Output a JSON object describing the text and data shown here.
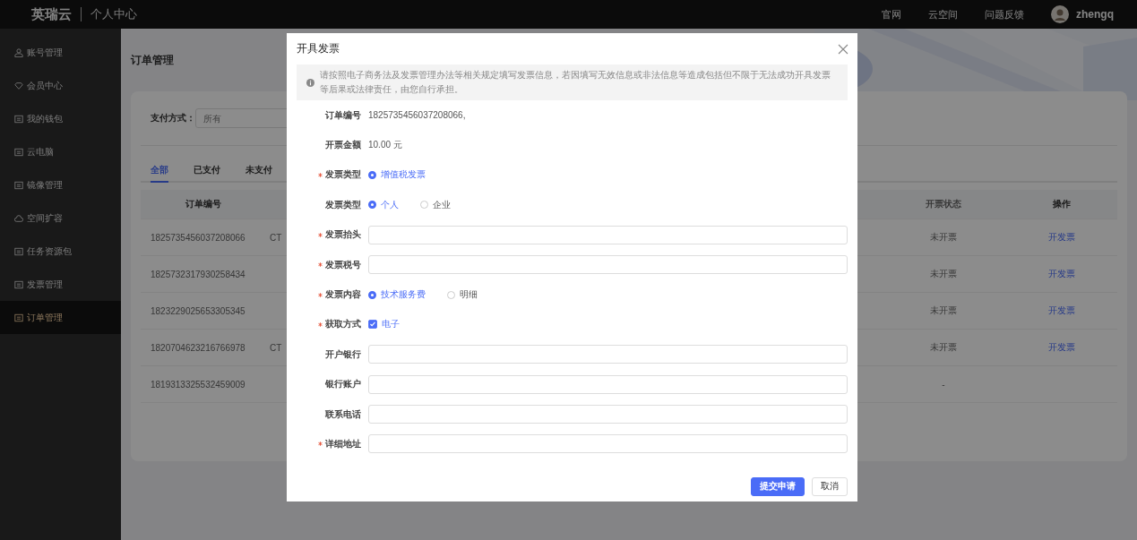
{
  "top_bar": {
    "logo": "英瑞云",
    "section": "个人中心",
    "links": [
      "官网",
      "云空间",
      "问题反馈"
    ],
    "user": "zhengq"
  },
  "sidebar": {
    "items": [
      {
        "label": "账号管理",
        "selected": false
      },
      {
        "label": "会员中心",
        "selected": false
      },
      {
        "label": "我的钱包",
        "selected": false
      },
      {
        "label": "云电脑",
        "selected": false
      },
      {
        "label": "镜像管理",
        "selected": false
      },
      {
        "label": "空间扩容",
        "selected": false
      },
      {
        "label": "任务资源包",
        "selected": false
      },
      {
        "label": "发票管理",
        "selected": false
      },
      {
        "label": "订单管理",
        "selected": true
      }
    ]
  },
  "page": {
    "title": "订单管理",
    "filter": {
      "label": "支付方式：",
      "placeholder": "所有"
    },
    "tabs": [
      {
        "label": "全部",
        "selected": true
      },
      {
        "label": "已支付",
        "selected": false
      },
      {
        "label": "未支付",
        "selected": false
      }
    ],
    "table": {
      "columns": [
        "订单编号",
        "开票状态",
        "操作"
      ],
      "rows": [
        {
          "order_no": "1825735456037208066",
          "column_2": "CT",
          "status": "未开票",
          "action": "开发票"
        },
        {
          "order_no": "1825732317930258434",
          "status": "未开票",
          "action": "开发票"
        },
        {
          "order_no": "1823229025653305345",
          "status": "未开票",
          "action": "开发票"
        },
        {
          "order_no": "1820704623216766978",
          "column_2": "CT",
          "status": "未开票",
          "action": "开发票"
        },
        {
          "order_no": "1819313325532459009",
          "status": "-"
        }
      ]
    }
  },
  "dialog": {
    "title": "开具发票",
    "notice": "请按照电子商务法及发票管理办法等相关规定填写发票信息，若因填写无效信息或非法信息等造成包括但不限于无法成功开具发票等后果或法律责任，由您自行承担。",
    "fields": [
      {
        "kind": "text",
        "label": "订单编号",
        "required": false,
        "value": "1825735456037208066,"
      },
      {
        "kind": "text",
        "label": "开票金额",
        "required": false,
        "value": "10.00 元"
      },
      {
        "kind": "radio",
        "label": "发票类型",
        "required": true,
        "options": [
          {
            "label": "增值税发票",
            "selected": true
          }
        ]
      },
      {
        "kind": "radio",
        "label": "发票类型",
        "required": false,
        "options": [
          {
            "label": "个人",
            "selected": true
          },
          {
            "label": "企业",
            "selected": false
          }
        ]
      },
      {
        "kind": "input",
        "label": "发票抬头",
        "required": true
      },
      {
        "kind": "input",
        "label": "发票税号",
        "required": true
      },
      {
        "kind": "radio",
        "label": "发票内容",
        "required": true,
        "options": [
          {
            "label": "技术服务费",
            "selected": true
          },
          {
            "label": "明细",
            "selected": false
          }
        ]
      },
      {
        "kind": "checkbox",
        "label": "获取方式",
        "required": true,
        "options": [
          {
            "label": "电子",
            "checked": true
          }
        ]
      },
      {
        "kind": "input",
        "label": "开户银行",
        "required": false
      },
      {
        "kind": "input",
        "label": "银行账户",
        "required": false
      },
      {
        "kind": "input",
        "label": "联系电话",
        "required": false
      },
      {
        "kind": "input",
        "label": "详细地址",
        "required": true
      }
    ],
    "buttons": [
      {
        "label": "提交申请",
        "kind": "primary"
      },
      {
        "label": "取消",
        "kind": "default"
      }
    ]
  }
}
